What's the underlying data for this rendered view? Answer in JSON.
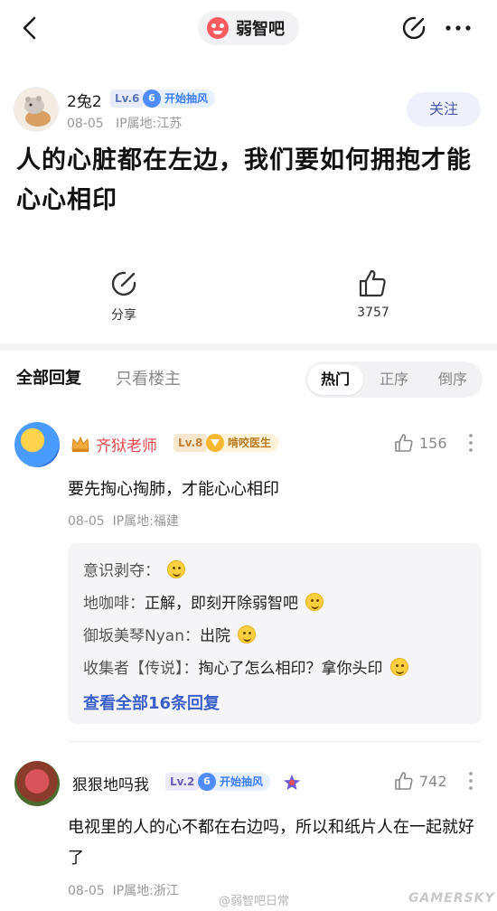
{
  "header": {
    "forum_name": "弱智吧",
    "icons": [
      "back-arrow-icon",
      "share-icon",
      "more-dots-icon"
    ]
  },
  "post": {
    "author": {
      "name": "2兔2",
      "level": "Lv.6",
      "fan_level": "6",
      "fan_badge": "开始抽风",
      "date": "08-05",
      "ip": "IP属地:江苏"
    },
    "follow_label": "关注",
    "title": "人的心脏都在左边，我们要如何拥抱才能心心相印",
    "share_label": "分享",
    "like_count": "3757"
  },
  "replies_header": {
    "tab_all": "全部回复",
    "tab_owner": "只看楼主",
    "sort": {
      "hot": "热门",
      "asc": "正序",
      "desc": "倒序",
      "active": "hot"
    }
  },
  "comments": [
    {
      "name": "齐狱老师",
      "level": "Lv.8",
      "title_badge": "啃咬医生",
      "like_count": "156",
      "text": "要先掏心掏肺，才能心心相印",
      "date": "08-05",
      "ip": "IP属地:福建",
      "sub_replies": [
        {
          "user": "意识剥夺：",
          "text": ""
        },
        {
          "user": "地咖啡：",
          "text": "正解，即刻开除弱智吧"
        },
        {
          "user": "御坂美琴Nyan：",
          "text": "出院"
        },
        {
          "user": "收集者【传说】：",
          "text": "掏心了怎么相印？拿你头印"
        }
      ],
      "view_all": "查看全部16条回复"
    },
    {
      "name": "狠狠地吗我",
      "level": "Lv.2",
      "fan_level": "6",
      "fan_badge": "开始抽风",
      "like_count": "742",
      "text": "电视里的人的心不都在右边吗，所以和纸片人在一起就好了",
      "date": "08-05",
      "ip": "IP属地:浙江"
    }
  ],
  "watermark": {
    "weibo": "@弱智吧日常",
    "site": "GAMERSKY"
  },
  "colors": {
    "vip_name": "#e5484d",
    "link": "#3a5fc8",
    "follow_bg": "#eef0fb"
  }
}
